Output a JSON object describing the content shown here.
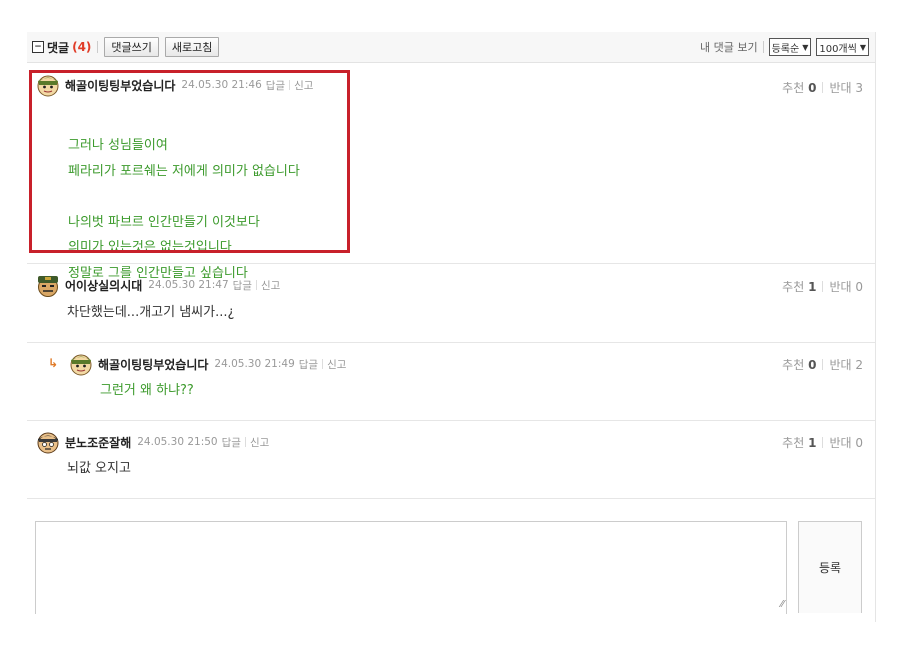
{
  "toolbar": {
    "toggle_icon": "minus-square-icon",
    "comments_label": "댓글",
    "comments_count": "(4)",
    "write_button": "댓글쓰기",
    "refresh_button": "새로고침",
    "my_comments_link": "내 댓글 보기",
    "sort_select": "등록순",
    "per_page_select": "100개씩"
  },
  "comments": [
    {
      "nickname": "해골이팅팅부었습니다",
      "datetime": "24.05.30 21:46",
      "reply": "답글",
      "report": "신고",
      "body": "그러나 성님들이여\n페라리가 포르쉐는 저에게 의미가 없습니다\n\n나의벗 파브르 인간만들기 이것보다\n의미가 있는것은 없는것입니다\n정말로 그를 인간만들고 싶습니다",
      "recommend_label": "추천",
      "recommend": "0",
      "oppose_label": "반대",
      "oppose": "3",
      "is_reply": false
    },
    {
      "nickname": "어이상실의시대",
      "datetime": "24.05.30 21:47",
      "reply": "답글",
      "report": "신고",
      "body": "차단했는데...개고기 냄씨가...¿",
      "recommend_label": "추천",
      "recommend": "1",
      "oppose_label": "반대",
      "oppose": "0",
      "is_reply": false
    },
    {
      "nickname": "해골이팅팅부었습니다",
      "datetime": "24.05.30 21:49",
      "reply": "답글",
      "report": "신고",
      "body": "그런거 왜 하냐??",
      "recommend_label": "추천",
      "recommend": "0",
      "oppose_label": "반대",
      "oppose": "2",
      "is_reply": true
    },
    {
      "nickname": "분노조준잘해",
      "datetime": "24.05.30 21:50",
      "reply": "답글",
      "report": "신고",
      "body": "뇌값 오지고",
      "recommend_label": "추천",
      "recommend": "1",
      "oppose_label": "반대",
      "oppose": "0",
      "is_reply": false
    }
  ],
  "composer": {
    "textarea_value": "",
    "submit_button": "등록"
  },
  "colors": {
    "count": "#e03c28",
    "green_text": "#3c9a2c",
    "highlight_border": "#c8202a",
    "reply_arrow": "#e07b28"
  }
}
